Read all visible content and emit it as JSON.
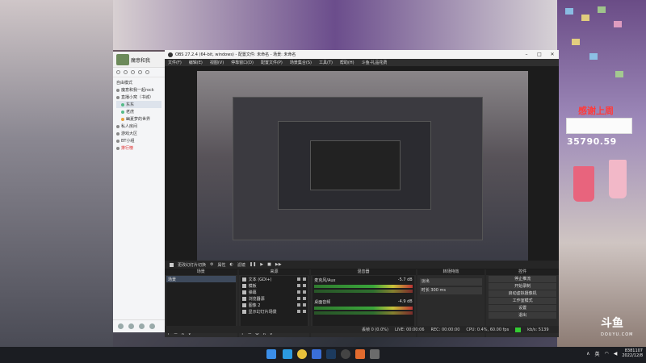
{
  "stream_overlay": {
    "thanks_text": "感谢上周",
    "counter_value": "35790.59",
    "brand": "斗鱼",
    "brand_en": "DOUYU.COM"
  },
  "chat_app": {
    "user_name": "魔意和我",
    "header_label": "自由模式",
    "items": [
      {
        "label": "魔意和我一起rock",
        "type": "group"
      },
      {
        "label": "直播小窝（书城）",
        "type": "group"
      },
      {
        "label": "东东",
        "type": "sub"
      },
      {
        "label": "老虎",
        "type": "sub"
      },
      {
        "label": "幽夏梦的世界",
        "type": "sub"
      },
      {
        "label": "私人房间",
        "type": "room"
      },
      {
        "label": "游戏大区",
        "type": "room"
      },
      {
        "label": "BT小组",
        "type": "room"
      },
      {
        "label": "排行榜",
        "type": "room-red"
      }
    ]
  },
  "obs": {
    "window_title": "OBS 27.2.4 (64-bit, windows) - 配置文件: 未命名 - 场景: 未命名",
    "menu": [
      "文件(F)",
      "编辑(E)",
      "视图(V)",
      "停靠窗口(D)",
      "配置文件(P)",
      "场景集合(S)",
      "工具(T)",
      "帮助(H)",
      "斗鱼-礼品花费"
    ],
    "scene_bar": {
      "toggle_label": "更改幻灯片切换",
      "props_label": "属性",
      "filter_label": "滤镜"
    },
    "docks": {
      "scenes_title": "场景",
      "scenes": [
        "场景"
      ],
      "sources_title": "来源",
      "sources": [
        "文本 (GDI+)",
        "模板",
        "弹幕",
        "浏览器源",
        "图像 2",
        "显示幻灯片场景"
      ],
      "mixer_title": "混音器",
      "mixer": [
        {
          "name": "桌面音频",
          "level": "-4.9 dB"
        },
        {
          "name": "麦克风/Aux",
          "level": "-5.7 dB"
        }
      ],
      "transitions_title": "转场特效",
      "transition": "淡出",
      "duration_label": "时长",
      "duration_value": "300 ms",
      "controls_title": "控件",
      "controls": [
        "停止推流",
        "开始录制",
        "启动虚拟摄像机",
        "工作室模式",
        "设置",
        "退出"
      ]
    },
    "status": {
      "dropped": "丢帧 0 (0.0%)",
      "live": "LIVE: 00:00:06",
      "rec": "REC: 00:00:00",
      "cpu": "CPU: 0.4%, 60.00 fps",
      "bitrate": "kb/s: 5139"
    }
  },
  "taskbar": {
    "lang": "英",
    "time_primary": "8381107",
    "clock_date": "2022/12/8"
  }
}
